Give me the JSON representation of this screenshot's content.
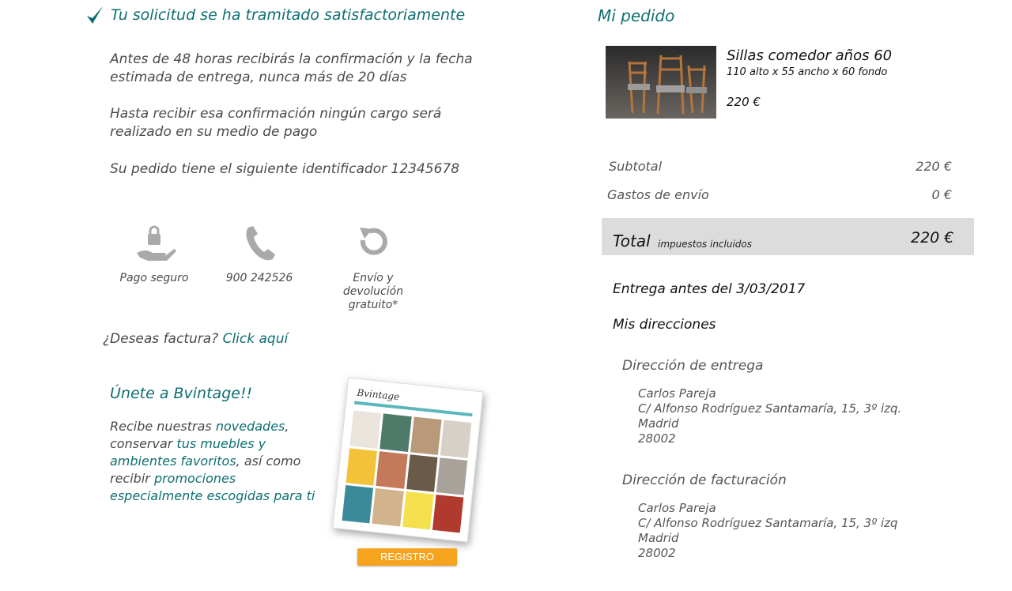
{
  "confirmation": {
    "title": "Tu solicitud se ha tramitado satisfactoriamente",
    "para1": "Antes de 48 horas recibirás la confirmación y la fecha estimada de entrega, nunca más de 20 días",
    "para2": "Hasta recibir esa confirmación ningún cargo será realizado en su medio de pago",
    "para3": "Su pedido tiene el siguiente identificador 12345678"
  },
  "features": [
    {
      "icon": "lock-hand-icon",
      "label": "Pago seguro"
    },
    {
      "icon": "phone-icon",
      "label": "900 242526"
    },
    {
      "icon": "return-arrow-icon",
      "label": "Envío y devolución gratuito*"
    }
  ],
  "invoice": {
    "question": "¿Deseas factura?",
    "link": "Click aquí"
  },
  "join": {
    "title": "Únete a Bvintage!!",
    "t1": "Recibe nuestras ",
    "h1": "novedades",
    "t2": ", conservar ",
    "h2": "tus muebles y ambientes favoritos",
    "t3": ", así como recibir ",
    "h3": "promociones especialmente escogidas para ti",
    "flyer_brand": "Bvintage",
    "button": "REGISTRO"
  },
  "order": {
    "title": "Mi pedido",
    "product": {
      "name": "Sillas comedor años 60",
      "dimensions": "110 alto x 55 ancho x 60 fondo",
      "price": "220 €"
    },
    "subtotal_label": "Subtotal",
    "subtotal_value": "220 €",
    "shipping_label": "Gastos de envío",
    "shipping_value": "0 €",
    "total_label": "Total",
    "total_note": "impuestos incluidos",
    "total_value": "220 €",
    "delivery": "Entrega antes del 3/03/2017",
    "addresses_title": "Mis direcciones",
    "shipping_address": {
      "heading": "Dirección de entrega",
      "name": "Carlos Pareja",
      "street": "C/ Alfonso Rodríguez Santamaría, 15, 3º izq.",
      "city": "Madrid",
      "zip": "28002"
    },
    "billing_address": {
      "heading": "Dirección de facturación",
      "name": "Carlos Pareja",
      "street": "C/ Alfonso Rodríguez Santamaría, 15, 3º izq",
      "city": "Madrid",
      "zip": "28002"
    }
  },
  "colors": {
    "accent": "#0d6e72",
    "button": "#f6a31e",
    "total_bg": "#dcdcdc"
  }
}
